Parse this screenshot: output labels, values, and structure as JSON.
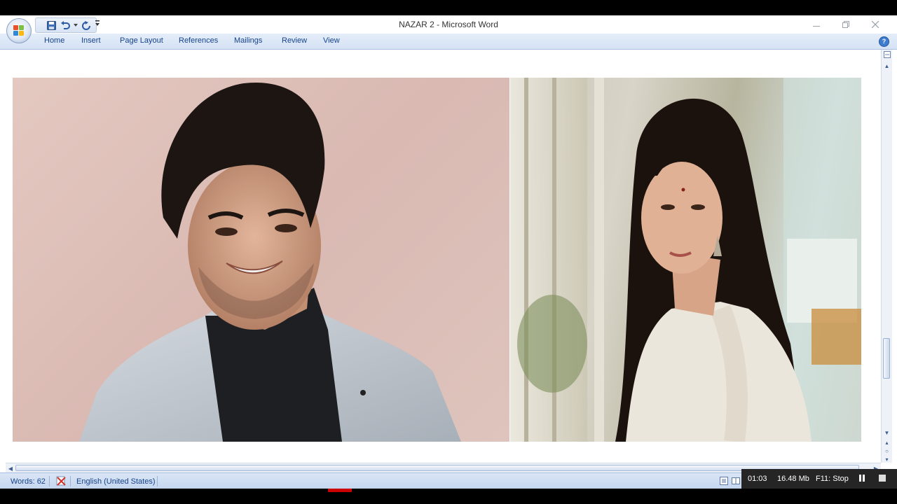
{
  "window": {
    "title": "NAZAR   2 - Microsoft Word"
  },
  "ribbon": {
    "tabs": [
      {
        "label": "Home"
      },
      {
        "label": "Insert"
      },
      {
        "label": "Page Layout"
      },
      {
        "label": "References"
      },
      {
        "label": "Mailings"
      },
      {
        "label": "Review"
      },
      {
        "label": "View"
      }
    ]
  },
  "quick_access": {
    "icons": [
      "save-icon",
      "undo-icon",
      "redo-icon",
      "customize-icon"
    ]
  },
  "document": {
    "images": [
      {
        "name": "man-in-gray-blazer-photo"
      },
      {
        "name": "woman-in-white-dress-photo"
      }
    ]
  },
  "statusbar": {
    "words": "Words: 62",
    "language": "English (United States)"
  },
  "recorder": {
    "time": "01:03",
    "size": "16.48 Mb",
    "stop_label": "F11: Stop"
  },
  "colors": {
    "ribbon_tab_text": "#15428b",
    "ribbon_bg": "#d5e2f4",
    "status_bg": "#c3d5ee",
    "recorder_bg": "#252525"
  }
}
